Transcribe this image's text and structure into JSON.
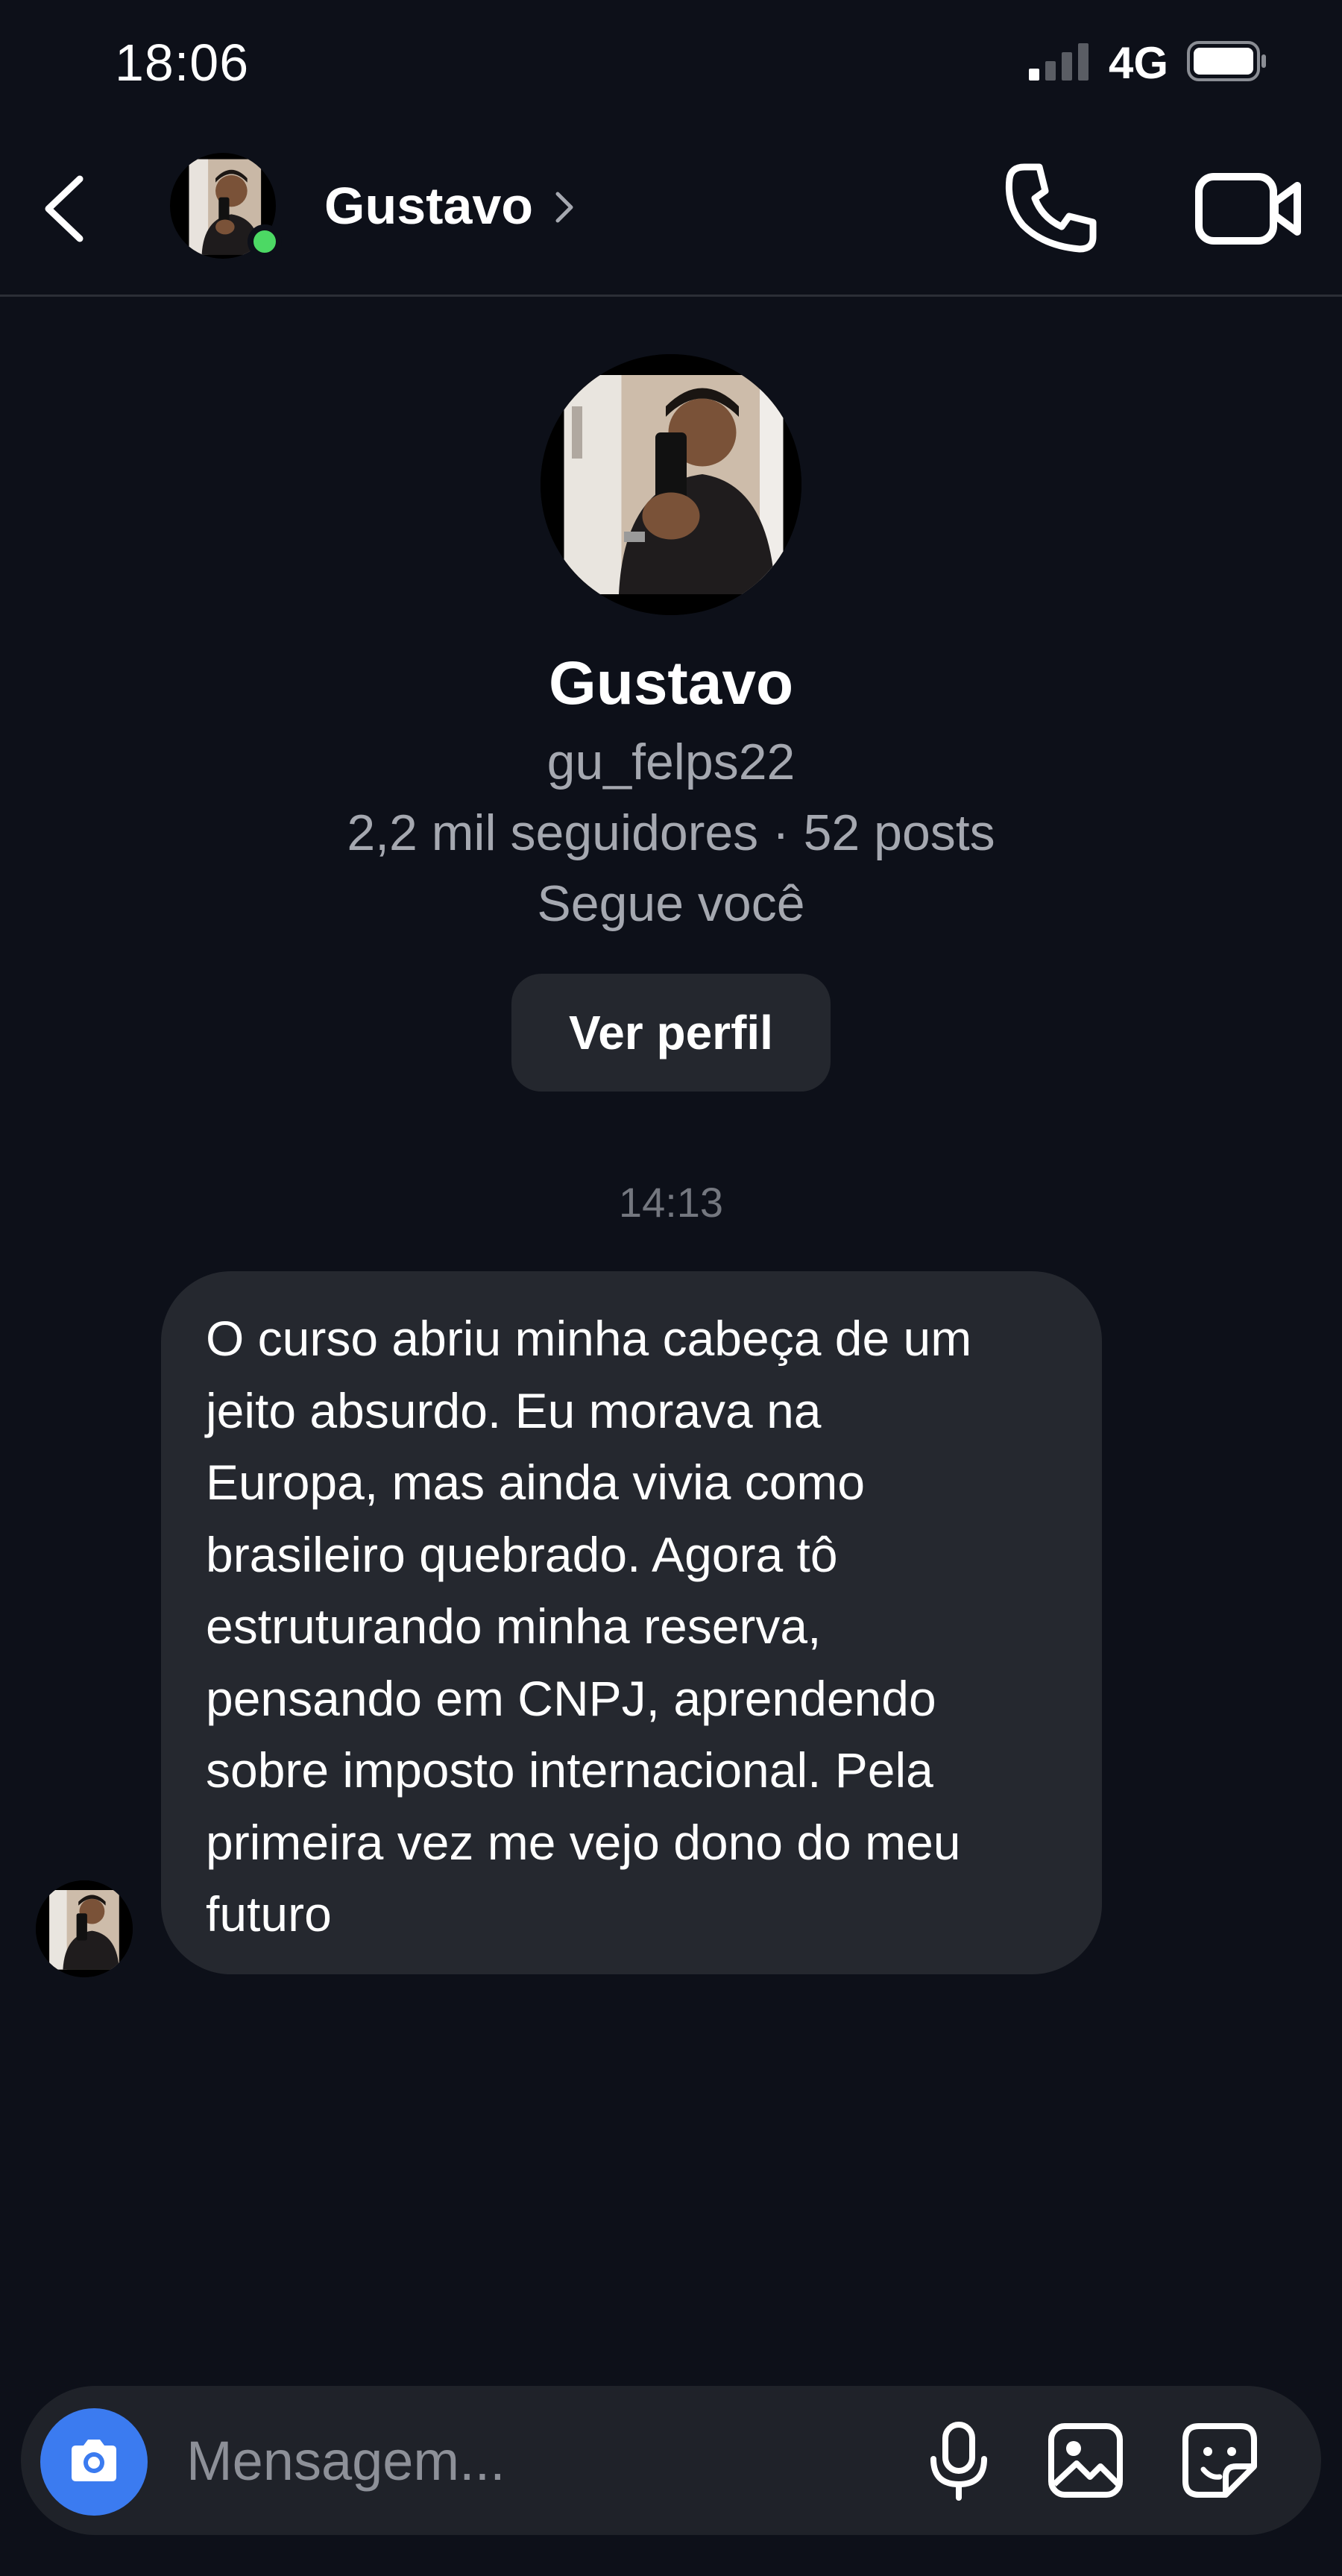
{
  "status_bar": {
    "time": "18:06",
    "network": "4G",
    "signal_icon": "signal-bars-icon",
    "battery_icon": "battery-icon"
  },
  "header": {
    "back_icon": "chevron-left-icon",
    "name": "Gustavo",
    "chevron_icon": "chevron-right-icon",
    "call_icon": "phone-icon",
    "video_icon": "video-camera-icon",
    "online_color": "#4cd964"
  },
  "profile": {
    "name": "Gustavo",
    "username": "gu_felps22",
    "stats": "2,2 mil seguidores · 52 posts",
    "follow_status": "Segue você",
    "view_profile_label": "Ver perfil"
  },
  "conversation": {
    "timestamp": "14:13",
    "messages": [
      {
        "text": "O curso abriu minha cabeça de um\njeito absurdo. Eu morava na\nEuropa, mas ainda vivia como\nbrasileiro quebrado. Agora tô\nestruturando minha reserva,\npensando em CNPJ, aprendendo\nsobre imposto internacional. Pela\nprimeira vez me vejo dono do meu\nfuturo"
      }
    ]
  },
  "composer": {
    "placeholder": "Mensagem...",
    "camera_icon": "camera-icon",
    "mic_icon": "microphone-icon",
    "gallery_icon": "image-icon",
    "sticker_icon": "sticker-icon",
    "accent_color": "#3b7bf0"
  },
  "colors": {
    "background": "#0d1019",
    "bubble": "#25282f",
    "secondary_text": "#a5a8b0"
  }
}
